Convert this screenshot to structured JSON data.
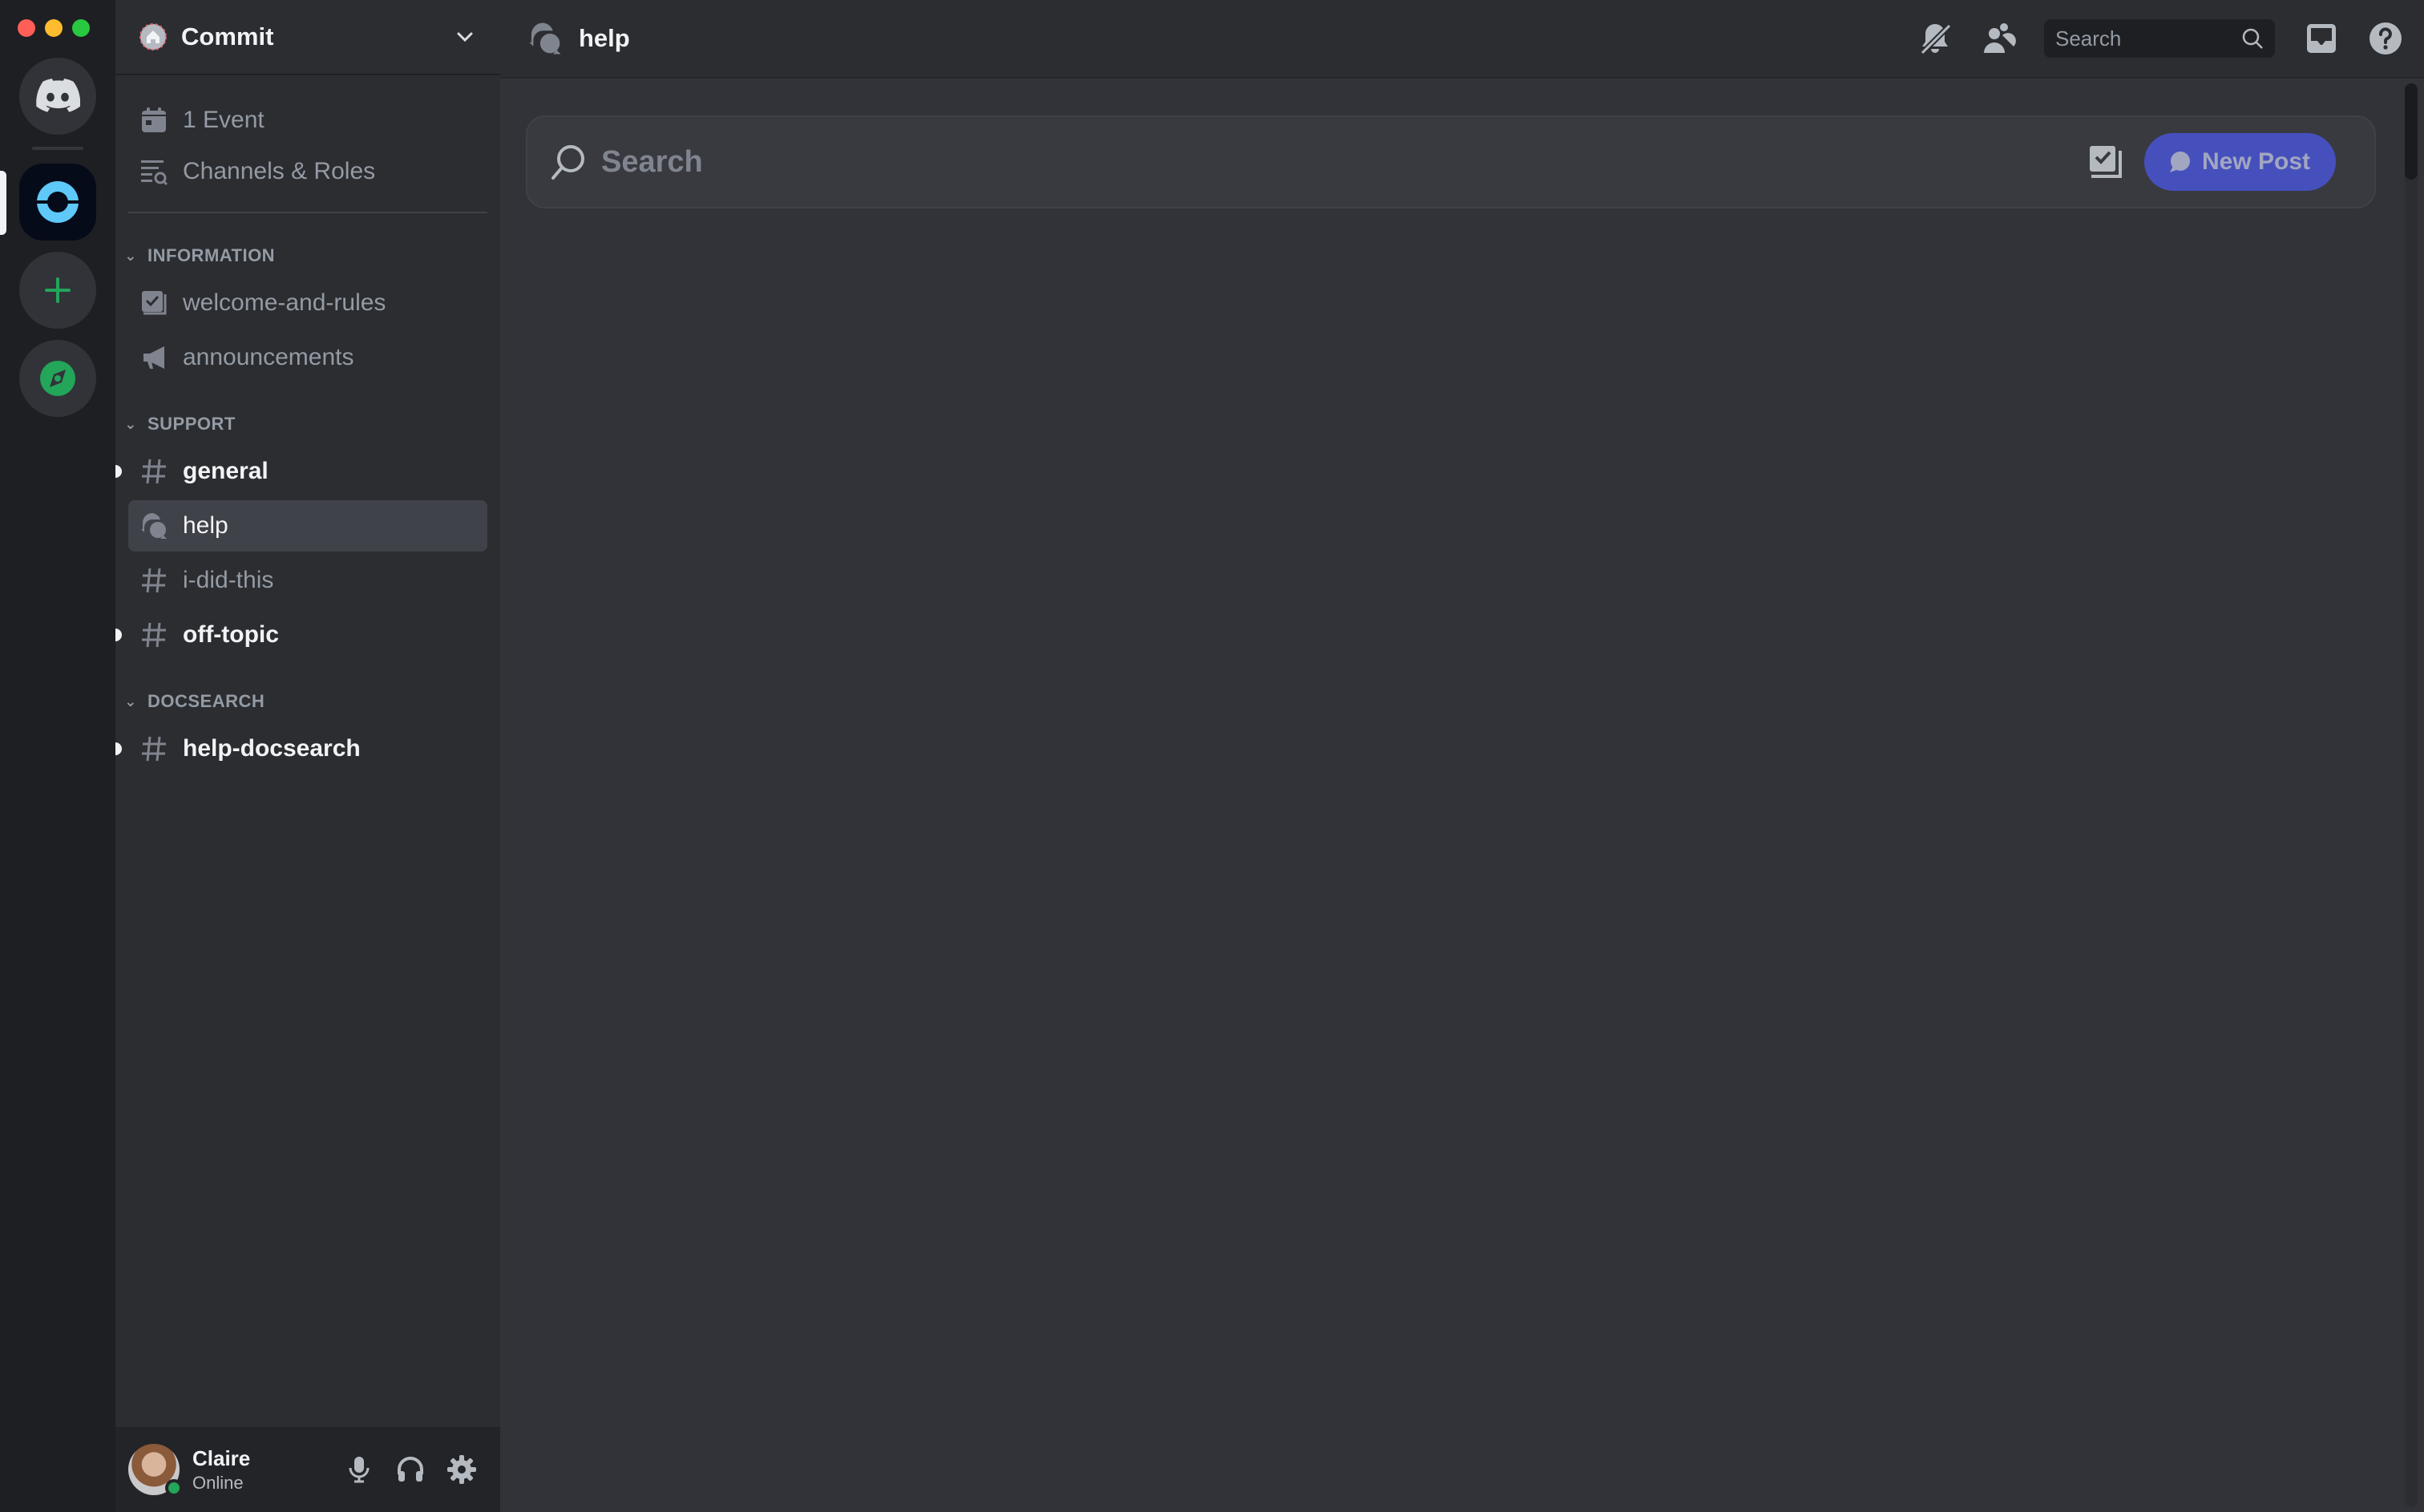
{
  "window": {
    "traffic_lights": {
      "close": "#ff5f57",
      "minimize": "#febc2e",
      "maximize": "#28c840"
    }
  },
  "servers": [
    {
      "name": "Direct Messages",
      "icon": "discord-logo-icon"
    },
    {
      "name": "Commit",
      "icon": "commit-server-icon",
      "selected": true
    },
    {
      "name": "Add a Server",
      "icon": "plus-icon"
    },
    {
      "name": "Explore Discoverable Servers",
      "icon": "compass-icon"
    }
  ],
  "guild": {
    "name": "Commit",
    "top_items": [
      {
        "label": "1 Event",
        "icon": "calendar-icon"
      },
      {
        "label": "Channels & Roles",
        "icon": "channels-roles-icon"
      }
    ],
    "categories": [
      {
        "name": "INFORMATION",
        "channels": [
          {
            "name": "welcome-and-rules",
            "icon": "rules-icon",
            "unread": false
          },
          {
            "name": "announcements",
            "icon": "megaphone-icon",
            "unread": false
          }
        ]
      },
      {
        "name": "SUPPORT",
        "channels": [
          {
            "name": "general",
            "icon": "hash-icon",
            "unread": true
          },
          {
            "name": "help",
            "icon": "forum-icon",
            "active": true
          },
          {
            "name": "i-did-this",
            "icon": "hash-icon",
            "unread": false
          },
          {
            "name": "off-topic",
            "icon": "hash-icon",
            "unread": true
          }
        ]
      },
      {
        "name": "DOCSEARCH",
        "channels": [
          {
            "name": "help-docsearch",
            "icon": "hash-icon",
            "unread": true
          }
        ]
      }
    ]
  },
  "user": {
    "name": "Claire",
    "status": "Online",
    "status_color": "#23a55a"
  },
  "header": {
    "channel_name": "help",
    "search_placeholder": "Search"
  },
  "forum": {
    "search_placeholder": "Search",
    "new_post_label": "New Post",
    "accent": "#4752c4"
  }
}
